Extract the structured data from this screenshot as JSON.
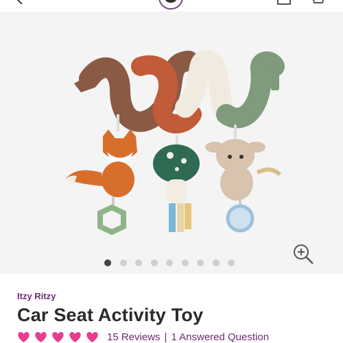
{
  "header": {
    "icons": [
      "back-arrow-icon",
      "brand-logo",
      "account-icon",
      "cart-icon"
    ]
  },
  "gallery": {
    "total_images": 9,
    "active_index": 0,
    "zoom_icon": "zoom-in-icon"
  },
  "product": {
    "brand": "Itzy Ritzy",
    "title": "Car Seat Activity Toy",
    "rating_hearts": 5,
    "reviews_label": "15 Reviews",
    "separator": "|",
    "questions_label": "1 Answered Question"
  },
  "colors": {
    "accent": "#6e2a73",
    "heart": "#e83d8e",
    "dot_active": "#444444",
    "dot_inactive": "#cfcfcf"
  }
}
